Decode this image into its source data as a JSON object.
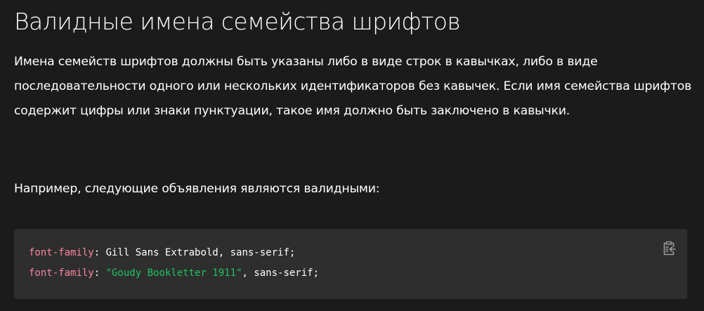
{
  "heading": "Валидные имена семейства шрифтов",
  "paragraphs": {
    "intro": "Имена семейств шрифтов должны быть указаны либо в виде строк в кавычках, либо в виде последовательности одного или нескольких идентификаторов без кавычек. Если имя семейства шрифтов содержит цифры или знаки пунктуации, такое имя должно быть заключено в кавычки.",
    "example": "Например, следующие объявления являются валидными:"
  },
  "code": {
    "line1": {
      "property": "font-family",
      "colon": ": ",
      "value": "Gill Sans Extrabold, sans-serif",
      "semicolon": ";"
    },
    "line2": {
      "property": "font-family",
      "colon": ": ",
      "string": "\"Goudy Bookletter 1911\"",
      "rest": ", sans-serif",
      "semicolon": ";"
    }
  },
  "copy_button": {
    "icon": "clipboard-copy-icon"
  },
  "colors": {
    "background": "#1b1b1b",
    "code_background": "#2e2e2e",
    "property": "#f9859f",
    "string": "#1fc461",
    "text": "#ffffff"
  }
}
